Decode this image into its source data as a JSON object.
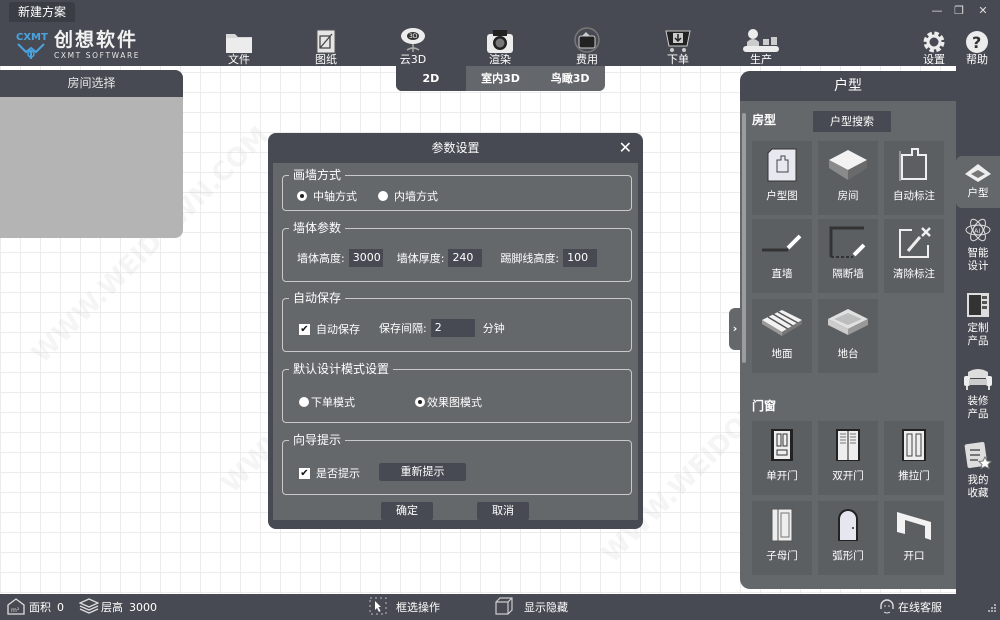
{
  "window": {
    "doc_tab": "新建方案",
    "controls": {
      "minimize": "—",
      "restore": "❐",
      "close": "✕"
    }
  },
  "logo": {
    "cn": "创想软件",
    "en": "CXMT SOFTWARE",
    "mark": "CXMT"
  },
  "toolbar": {
    "items": [
      {
        "label": "文件",
        "icon": "folder-icon"
      },
      {
        "label": "图纸",
        "icon": "drawing-icon"
      },
      {
        "label": "云3D",
        "icon": "cloud-3d-icon"
      },
      {
        "label": "渲染",
        "icon": "camera-icon"
      },
      {
        "label": "费用",
        "icon": "wallet-icon"
      },
      {
        "label": "下单",
        "icon": "cart-icon"
      },
      {
        "label": "生产",
        "icon": "production-icon"
      },
      {
        "label": "设置",
        "icon": "gear-icon"
      },
      {
        "label": "帮助",
        "icon": "help-icon"
      }
    ]
  },
  "view_tabs": [
    {
      "label": "2D",
      "active": true
    },
    {
      "label": "室内3D",
      "active": false
    },
    {
      "label": "鸟瞰3D",
      "active": false
    }
  ],
  "room_panel": {
    "title": "房间选择"
  },
  "dialog": {
    "title": "参数设置",
    "close": "✕",
    "wall_mode": {
      "title": "画墙方式",
      "options": [
        {
          "label": "中轴方式",
          "selected": true
        },
        {
          "label": "内墙方式",
          "selected": false
        }
      ]
    },
    "wall_params": {
      "title": "墙体参数",
      "height_label": "墙体高度:",
      "height_value": "3000",
      "thickness_label": "墙体厚度:",
      "thickness_value": "240",
      "baseboard_label": "踢脚线高度:",
      "baseboard_value": "100"
    },
    "autosave": {
      "title": "自动保存",
      "check_label": "自动保存",
      "checked": true,
      "interval_label": "保存间隔:",
      "interval_value": "2",
      "unit": "分钟"
    },
    "design_mode": {
      "title": "默认设计模式设置",
      "options": [
        {
          "label": "下单模式",
          "selected": false
        },
        {
          "label": "效果图模式",
          "selected": true
        }
      ]
    },
    "guide": {
      "title": "向导提示",
      "check_label": "是否提示",
      "checked": true,
      "reset_label": "重新提示"
    },
    "ok_label": "确定",
    "cancel_label": "取消"
  },
  "right_panel": {
    "title": "户型",
    "section_house": "房型",
    "search_label": "户型搜索",
    "house_tiles": [
      {
        "label": "户型图",
        "icon": "floorplan-icon"
      },
      {
        "label": "房间",
        "icon": "room-icon"
      },
      {
        "label": "自动标注",
        "icon": "auto-dimension-icon"
      },
      {
        "label": "直墙",
        "icon": "straight-wall-icon"
      },
      {
        "label": "隔断墙",
        "icon": "partition-wall-icon"
      },
      {
        "label": "清除标注",
        "icon": "clear-dimension-icon"
      },
      {
        "label": "地面",
        "icon": "floor-icon"
      },
      {
        "label": "地台",
        "icon": "platform-icon"
      }
    ],
    "section_doors": "门窗",
    "door_tiles": [
      {
        "label": "单开门",
        "icon": "single-door-icon"
      },
      {
        "label": "双开门",
        "icon": "double-door-icon"
      },
      {
        "label": "推拉门",
        "icon": "sliding-door-icon"
      },
      {
        "label": "子母门",
        "icon": "mother-son-door-icon"
      },
      {
        "label": "弧形门",
        "icon": "arched-door-icon"
      },
      {
        "label": "开口",
        "icon": "opening-icon"
      }
    ]
  },
  "side_nav": [
    {
      "label": "户型",
      "active": true
    },
    {
      "label": "智能设计",
      "active": false
    },
    {
      "label": "定制产品",
      "active": false
    },
    {
      "label": "装修产品",
      "active": false
    },
    {
      "label": "我的收藏",
      "active": false
    }
  ],
  "status": {
    "area_label": "面积",
    "area_value": "0",
    "floor_height_label": "层高",
    "floor_height_value": "3000",
    "box_select": "框选操作",
    "show_hide": "显示隐藏",
    "online_service": "在线客服"
  },
  "watermark": "WWW.WEIDOWN.COM"
}
